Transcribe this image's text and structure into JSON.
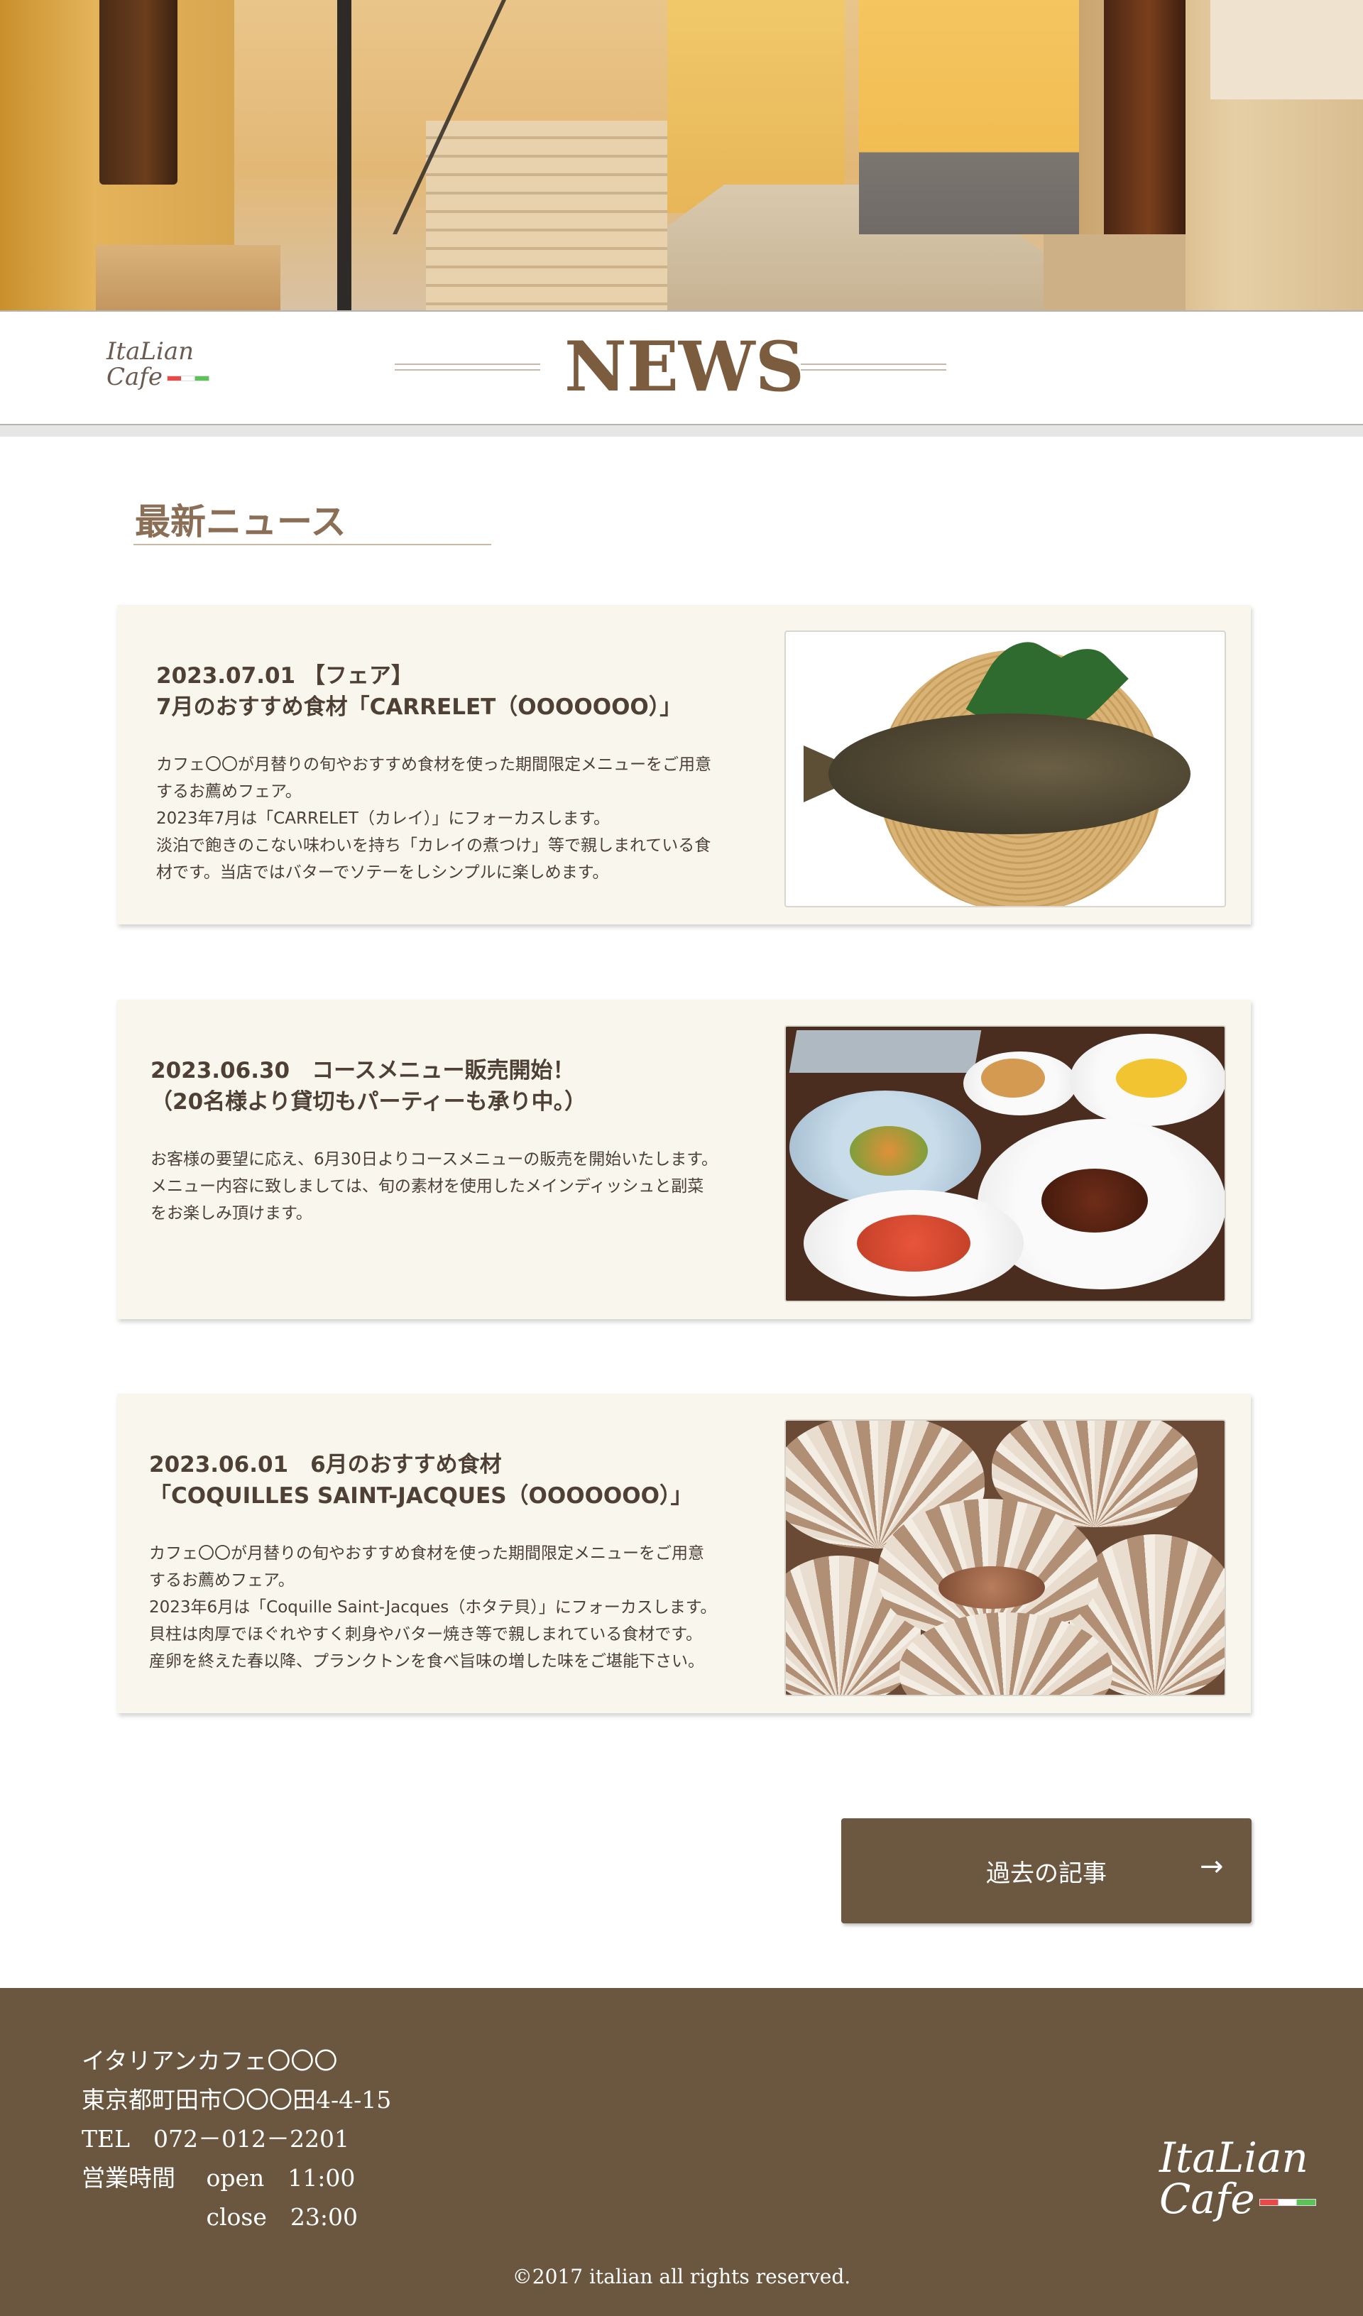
{
  "header": {
    "logo_line1": "ItaLian",
    "logo_line2": "Cafe",
    "page_title": "NEWS"
  },
  "section": {
    "title": "最新ニュース"
  },
  "news": [
    {
      "title_lines": [
        "2023.07.01 【フェア】",
        "7月のおすすめ食材「CARRELET（OOOOOOO）」"
      ],
      "body_lines": [
        "カフェ〇〇が月替りの旬やおすすめ食材を使った期間限定メニューをご用意",
        "するお薦めフェア。",
        "2023年7月は「CARRELET（カレイ）」にフォーカスします。",
        "淡泊で飽きのこない味わいを持ち「カレイの煮つけ」等で親しまれている食",
        "材です。当店ではバターでソテーをしシンプルに楽しめます。"
      ]
    },
    {
      "title_lines": [
        "2023.06.30　コースメニュー販売開始！",
        "（20名様より貸切もパーティーも承り中。）"
      ],
      "body_lines": [
        "お客様の要望に応え、6月30日よりコースメニューの販売を開始いたします。",
        "メニュー内容に致しましては、旬の素材を使用したメインディッシュと副菜",
        "をお楽しみ頂けます。"
      ]
    },
    {
      "title_lines": [
        "2023.06.01　6月のおすすめ食材",
        "「COQUILLES SAINT-JACQUES（OOOOOOO）」"
      ],
      "body_lines": [
        "カフェ〇〇が月替りの旬やおすすめ食材を使った期間限定メニューをご用意",
        "するお薦めフェア。",
        "2023年6月は「Coquille Saint-Jacques（ホタテ貝）」にフォーカスします。",
        "貝柱は肉厚でほぐれやすく刺身やバター焼き等で親しまれている食材です。",
        "産卵を終えた春以降、プランクトンを食べ旨味の増した味をご堪能下さい。"
      ]
    }
  ],
  "archive_button": {
    "label": "過去の記事",
    "arrow": "→"
  },
  "footer": {
    "shop_name": "イタリアンカフェ〇〇〇",
    "address": "東京都町田市〇〇〇田4-4-15",
    "tel": "TEL　072－012－2201",
    "hours_open": "営業時間　 open　11:00",
    "hours_close": "　　　　　 close　23:00",
    "logo_line1": "ItaLian",
    "logo_line2": "Cafe",
    "copyright": "©2017 italian all rights reserved."
  },
  "colors": {
    "accent_brown": "#6b5740",
    "title_brown": "#7b5c3e",
    "card_bg": "#f9f6ed"
  }
}
